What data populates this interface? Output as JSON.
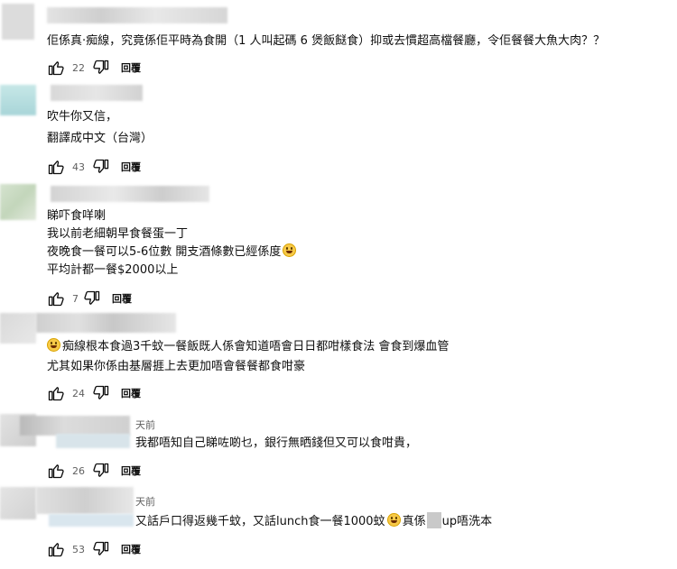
{
  "comments": [
    {
      "lines": [
        "佢係真·痴線，究竟係佢平時為食開（1 人叫起碼 6 煲飯餸食）抑或去慣超高檔餐廳，令佢餐餐大魚大肉？？"
      ],
      "likes": "22",
      "reply_label": "回覆"
    },
    {
      "lines": [
        "吹牛你又信，",
        "翻譯成中文（台灣）"
      ],
      "likes": "43",
      "reply_label": "回覆"
    },
    {
      "lines": [
        "睇吓食咩喇",
        "我以前老細朝早食餐蛋一丁",
        "夜晚食一餐可以5-6位數 開支酒條數已經係度",
        "平均計都一餐$2000以上"
      ],
      "likes": "7",
      "reply_label": "回覆"
    },
    {
      "lines": [
        "痴線根本食過3千蚊一餐飯既人係會知道唔會日日都咁樣食法 會食到爆血管",
        "尤其如果你係由基層捱上去更加唔會餐餐都食咁豪"
      ],
      "likes": "24",
      "reply_label": "回覆"
    },
    {
      "meta": "天前",
      "lines": [
        "我都唔知自己睇咗啲乜，銀行無晒錢但又可以食咁貴，"
      ],
      "likes": "26",
      "reply_label": "回覆"
    },
    {
      "meta": "天前",
      "line_a": "又話戶口得返幾千蚊，又話lunch食一餐1000蚊",
      "line_b": "真係",
      "line_c": "up唔洗本",
      "likes": "53",
      "reply_label": "回覆"
    }
  ],
  "icons": {
    "like": "thumbs-up-icon",
    "dislike": "thumbs-down-icon",
    "emoji": "grinning-face-emoji-icon"
  }
}
